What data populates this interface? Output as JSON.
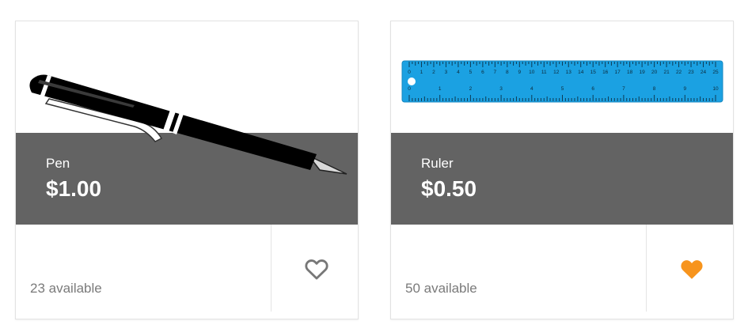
{
  "products": [
    {
      "name": "Pen",
      "price": "$1.00",
      "availability": "23 available",
      "favorite": false,
      "image_icon": "pen-image"
    },
    {
      "name": "Ruler",
      "price": "$0.50",
      "availability": "50 available",
      "favorite": true,
      "image_icon": "ruler-image",
      "ruler_top_scale": [
        "0",
        "1",
        "2",
        "3",
        "4",
        "5",
        "6",
        "7",
        "8",
        "9",
        "10",
        "11",
        "12",
        "13",
        "14",
        "15",
        "16",
        "17",
        "18",
        "19",
        "20",
        "21",
        "22",
        "23",
        "24",
        "25"
      ],
      "ruler_bottom_scale": [
        "0",
        "1",
        "2",
        "3",
        "4",
        "5",
        "6",
        "7",
        "8",
        "9",
        "10"
      ]
    }
  ],
  "colors": {
    "banner": "#636363",
    "favorite_active": "#f7941d",
    "favorite_inactive": "#777777",
    "ruler": "#1ba1e2"
  }
}
